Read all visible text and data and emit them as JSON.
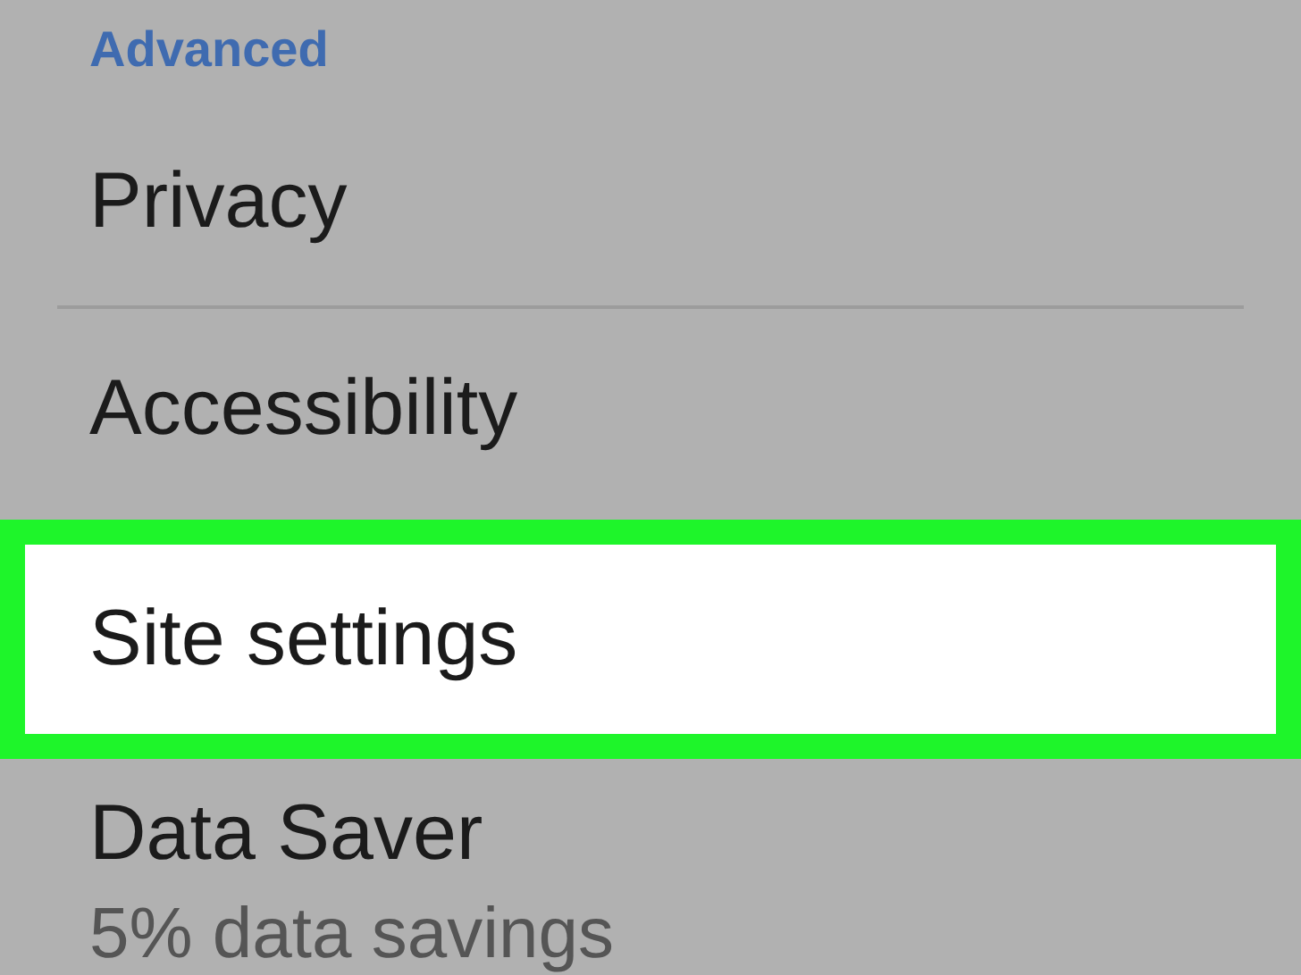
{
  "section": {
    "title": "Advanced"
  },
  "items": [
    {
      "title": "Privacy",
      "selected": false,
      "divider_below": true
    },
    {
      "title": "Accessibility",
      "selected": false,
      "divider_below": false
    },
    {
      "title": "Site settings",
      "selected": true,
      "divider_below": false
    },
    {
      "title": "Data Saver",
      "subtitle": "5% data savings",
      "selected": false,
      "divider_below": false
    }
  ]
}
